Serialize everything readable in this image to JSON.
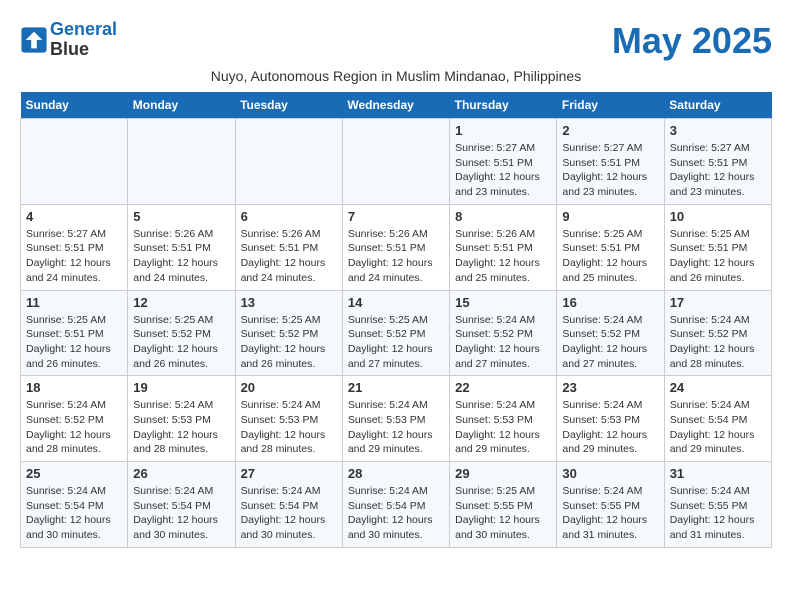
{
  "header": {
    "logo_line1": "General",
    "logo_line2": "Blue",
    "month_title": "May 2025",
    "subtitle": "Nuyo, Autonomous Region in Muslim Mindanao, Philippines"
  },
  "days_of_week": [
    "Sunday",
    "Monday",
    "Tuesday",
    "Wednesday",
    "Thursday",
    "Friday",
    "Saturday"
  ],
  "weeks": [
    [
      {
        "day": "",
        "info": ""
      },
      {
        "day": "",
        "info": ""
      },
      {
        "day": "",
        "info": ""
      },
      {
        "day": "",
        "info": ""
      },
      {
        "day": "1",
        "info": "Sunrise: 5:27 AM\nSunset: 5:51 PM\nDaylight: 12 hours\nand 23 minutes."
      },
      {
        "day": "2",
        "info": "Sunrise: 5:27 AM\nSunset: 5:51 PM\nDaylight: 12 hours\nand 23 minutes."
      },
      {
        "day": "3",
        "info": "Sunrise: 5:27 AM\nSunset: 5:51 PM\nDaylight: 12 hours\nand 23 minutes."
      }
    ],
    [
      {
        "day": "4",
        "info": "Sunrise: 5:27 AM\nSunset: 5:51 PM\nDaylight: 12 hours\nand 24 minutes."
      },
      {
        "day": "5",
        "info": "Sunrise: 5:26 AM\nSunset: 5:51 PM\nDaylight: 12 hours\nand 24 minutes."
      },
      {
        "day": "6",
        "info": "Sunrise: 5:26 AM\nSunset: 5:51 PM\nDaylight: 12 hours\nand 24 minutes."
      },
      {
        "day": "7",
        "info": "Sunrise: 5:26 AM\nSunset: 5:51 PM\nDaylight: 12 hours\nand 24 minutes."
      },
      {
        "day": "8",
        "info": "Sunrise: 5:26 AM\nSunset: 5:51 PM\nDaylight: 12 hours\nand 25 minutes."
      },
      {
        "day": "9",
        "info": "Sunrise: 5:25 AM\nSunset: 5:51 PM\nDaylight: 12 hours\nand 25 minutes."
      },
      {
        "day": "10",
        "info": "Sunrise: 5:25 AM\nSunset: 5:51 PM\nDaylight: 12 hours\nand 26 minutes."
      }
    ],
    [
      {
        "day": "11",
        "info": "Sunrise: 5:25 AM\nSunset: 5:51 PM\nDaylight: 12 hours\nand 26 minutes."
      },
      {
        "day": "12",
        "info": "Sunrise: 5:25 AM\nSunset: 5:52 PM\nDaylight: 12 hours\nand 26 minutes."
      },
      {
        "day": "13",
        "info": "Sunrise: 5:25 AM\nSunset: 5:52 PM\nDaylight: 12 hours\nand 26 minutes."
      },
      {
        "day": "14",
        "info": "Sunrise: 5:25 AM\nSunset: 5:52 PM\nDaylight: 12 hours\nand 27 minutes."
      },
      {
        "day": "15",
        "info": "Sunrise: 5:24 AM\nSunset: 5:52 PM\nDaylight: 12 hours\nand 27 minutes."
      },
      {
        "day": "16",
        "info": "Sunrise: 5:24 AM\nSunset: 5:52 PM\nDaylight: 12 hours\nand 27 minutes."
      },
      {
        "day": "17",
        "info": "Sunrise: 5:24 AM\nSunset: 5:52 PM\nDaylight: 12 hours\nand 28 minutes."
      }
    ],
    [
      {
        "day": "18",
        "info": "Sunrise: 5:24 AM\nSunset: 5:52 PM\nDaylight: 12 hours\nand 28 minutes."
      },
      {
        "day": "19",
        "info": "Sunrise: 5:24 AM\nSunset: 5:53 PM\nDaylight: 12 hours\nand 28 minutes."
      },
      {
        "day": "20",
        "info": "Sunrise: 5:24 AM\nSunset: 5:53 PM\nDaylight: 12 hours\nand 28 minutes."
      },
      {
        "day": "21",
        "info": "Sunrise: 5:24 AM\nSunset: 5:53 PM\nDaylight: 12 hours\nand 29 minutes."
      },
      {
        "day": "22",
        "info": "Sunrise: 5:24 AM\nSunset: 5:53 PM\nDaylight: 12 hours\nand 29 minutes."
      },
      {
        "day": "23",
        "info": "Sunrise: 5:24 AM\nSunset: 5:53 PM\nDaylight: 12 hours\nand 29 minutes."
      },
      {
        "day": "24",
        "info": "Sunrise: 5:24 AM\nSunset: 5:54 PM\nDaylight: 12 hours\nand 29 minutes."
      }
    ],
    [
      {
        "day": "25",
        "info": "Sunrise: 5:24 AM\nSunset: 5:54 PM\nDaylight: 12 hours\nand 30 minutes."
      },
      {
        "day": "26",
        "info": "Sunrise: 5:24 AM\nSunset: 5:54 PM\nDaylight: 12 hours\nand 30 minutes."
      },
      {
        "day": "27",
        "info": "Sunrise: 5:24 AM\nSunset: 5:54 PM\nDaylight: 12 hours\nand 30 minutes."
      },
      {
        "day": "28",
        "info": "Sunrise: 5:24 AM\nSunset: 5:54 PM\nDaylight: 12 hours\nand 30 minutes."
      },
      {
        "day": "29",
        "info": "Sunrise: 5:25 AM\nSunset: 5:55 PM\nDaylight: 12 hours\nand 30 minutes."
      },
      {
        "day": "30",
        "info": "Sunrise: 5:24 AM\nSunset: 5:55 PM\nDaylight: 12 hours\nand 31 minutes."
      },
      {
        "day": "31",
        "info": "Sunrise: 5:24 AM\nSunset: 5:55 PM\nDaylight: 12 hours\nand 31 minutes."
      }
    ]
  ]
}
